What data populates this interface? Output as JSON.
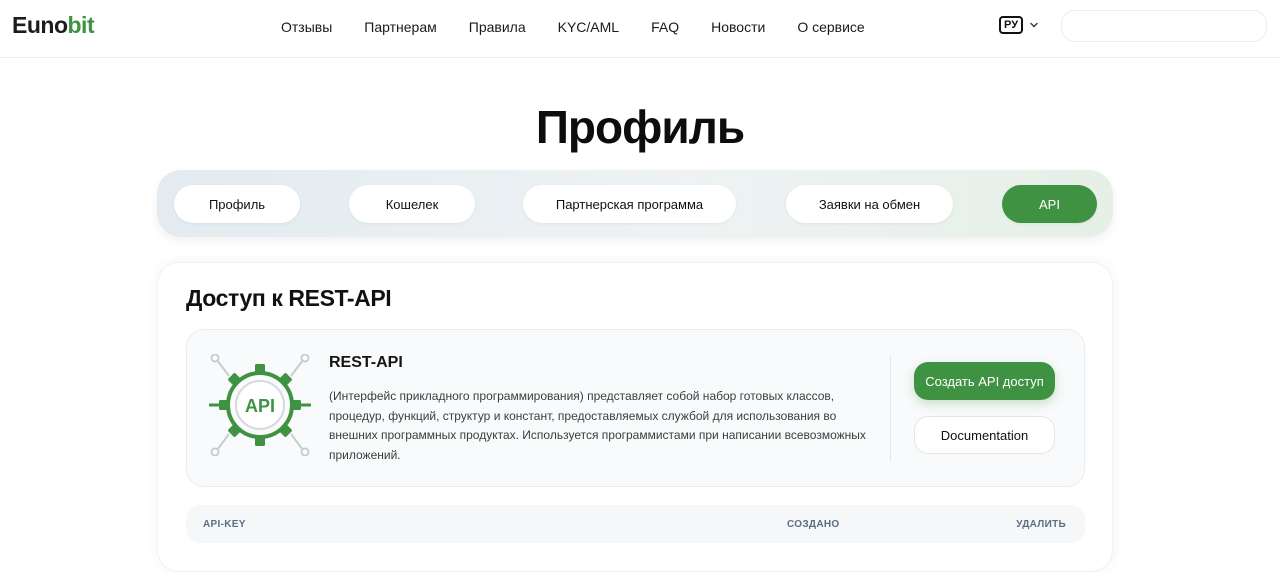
{
  "header": {
    "logo_part1": "Euno",
    "logo_part2": "bit",
    "nav": [
      "Отзывы",
      "Партнерам",
      "Правила",
      "KYC/AML",
      "FAQ",
      "Новости",
      "О сервисе"
    ],
    "language": "РУ"
  },
  "page": {
    "title": "Профиль"
  },
  "tabs": [
    {
      "label": "Профиль",
      "active": false
    },
    {
      "label": "Кошелек",
      "active": false
    },
    {
      "label": "Партнерская программа",
      "active": false
    },
    {
      "label": "Заявки на обмен",
      "active": false
    },
    {
      "label": "API",
      "active": true
    }
  ],
  "card": {
    "title": "Доступ к REST-API",
    "api": {
      "icon_text": "API",
      "name": "REST-API",
      "description": "(Интерфейс прикладного программирования) представляет собой набор готовых классов, процедур, функций, структур и констант, предоставляемых службой для использования во внешних программных продуктах. Используется программистами при написании всевозможных приложений.",
      "create_button": "Создать API доступ",
      "docs_button": "Documentation"
    },
    "table": {
      "columns": [
        "API-KEY",
        "СОЗДАНО",
        "УДАЛИТЬ"
      ]
    }
  },
  "colors": {
    "accent": "#3f9242",
    "text": "#111111"
  }
}
